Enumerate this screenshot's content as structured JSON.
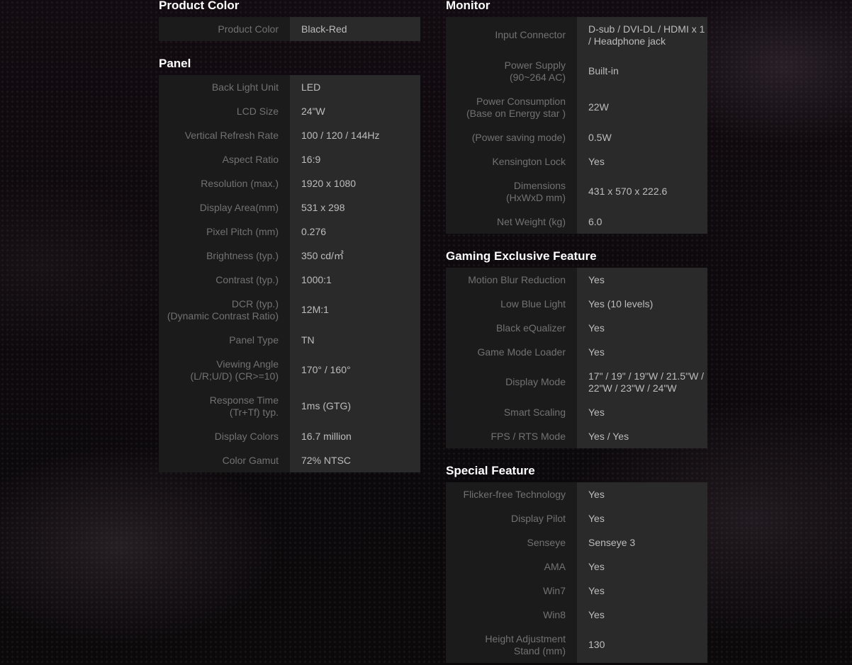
{
  "left_column": {
    "product_color": {
      "title": "Product Color",
      "rows": [
        {
          "label": "Product Color",
          "value": "Black-Red"
        }
      ]
    },
    "panel": {
      "title": "Panel",
      "rows": [
        {
          "label": "Back Light Unit",
          "value": "LED"
        },
        {
          "label": "LCD Size",
          "value": "24\"W"
        },
        {
          "label": "Vertical Refresh Rate",
          "value": "100 / 120 / 144Hz"
        },
        {
          "label": "Aspect Ratio",
          "value": "16:9"
        },
        {
          "label": "Resolution (max.)",
          "value": "1920 x 1080"
        },
        {
          "label": "Display Area(mm)",
          "value": "531 x 298"
        },
        {
          "label": "Pixel Pitch (mm)",
          "value": "0.276"
        },
        {
          "label": "Brightness (typ.)",
          "value": "350 cd/㎡"
        },
        {
          "label": "Contrast (typ.)",
          "value": "1000:1"
        },
        {
          "label_line1": "DCR (typ.)",
          "label_line2": "(Dynamic Contrast Ratio)",
          "value": "12M:1"
        },
        {
          "label": "Panel Type",
          "value": "TN"
        },
        {
          "label_line1": "Viewing Angle",
          "label_line2": "(L/R;U/D) (CR>=10)",
          "value": "170° / 160°"
        },
        {
          "label_line1": "Response Time",
          "label_line2": "(Tr+Tf) typ.",
          "value": "1ms (GTG)"
        },
        {
          "label": "Display Colors",
          "value": "16.7 million"
        },
        {
          "label": "Color Gamut",
          "value": "72% NTSC"
        }
      ]
    }
  },
  "right_column": {
    "monitor": {
      "title": "Monitor",
      "rows": [
        {
          "label": "Input Connector",
          "value_line1": "D-sub / DVI-DL / HDMI x 1",
          "value_line2": "/ Headphone jack"
        },
        {
          "label_line1": "Power Supply",
          "label_line2": "(90~264 AC)",
          "value": "Built-in"
        },
        {
          "label_line1": "Power Consumption",
          "label_line2": "(Base on Energy star )",
          "value": "22W"
        },
        {
          "label": "(Power saving mode)",
          "value": "0.5W"
        },
        {
          "label": "Kensington Lock",
          "value": "Yes"
        },
        {
          "label_line1": "Dimensions",
          "label_line2": "(HxWxD mm)",
          "value": "431 x 570 x 222.6"
        },
        {
          "label": "Net Weight (kg)",
          "value": "6.0"
        }
      ]
    },
    "gaming": {
      "title": "Gaming Exclusive Feature",
      "rows": [
        {
          "label": "Motion Blur Reduction",
          "value": "Yes"
        },
        {
          "label": "Low Blue Light",
          "value": "Yes (10 levels)"
        },
        {
          "label": "Black eQualizer",
          "value": "Yes"
        },
        {
          "label": "Game Mode Loader",
          "value": "Yes"
        },
        {
          "label": "Display Mode",
          "value_line1": "17\" / 19\" / 19\"W / 21.5\"W /",
          "value_line2": "22\"W / 23\"W / 24\"W"
        },
        {
          "label": "Smart Scaling",
          "value": "Yes"
        },
        {
          "label": "FPS / RTS Mode",
          "value": "Yes / Yes"
        }
      ]
    },
    "special": {
      "title": "Special Feature",
      "rows": [
        {
          "label": "Flicker-free Technology",
          "value": "Yes"
        },
        {
          "label": "Display Pilot",
          "value": "Yes"
        },
        {
          "label": "Senseye",
          "value": "Senseye 3"
        },
        {
          "label": "AMA",
          "value": "Yes"
        },
        {
          "label": "Win7",
          "value": "Yes"
        },
        {
          "label": "Win8",
          "value": "Yes"
        },
        {
          "label_line1": "Height Adjustment",
          "label_line2": "Stand (mm)",
          "value": "130"
        }
      ]
    }
  }
}
